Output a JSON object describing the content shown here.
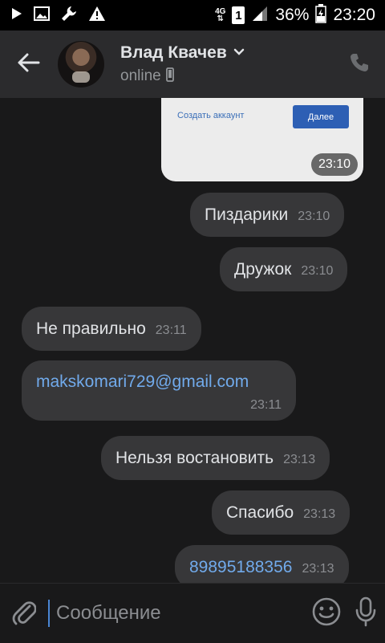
{
  "status_bar": {
    "battery": "36%",
    "time": "23:20",
    "network": "4G",
    "sim": "1",
    "icons": [
      "play-icon",
      "image-icon",
      "wrench-icon",
      "warning-icon",
      "signal-icon",
      "battery-icon"
    ]
  },
  "header": {
    "name": "Влад Квачев",
    "status": "online",
    "icons": [
      "back-arrow-icon",
      "chevron-down-icon",
      "phone-device-icon",
      "call-icon"
    ]
  },
  "image_message": {
    "link_text": "Создать аккаунт",
    "button_text": "Далее",
    "time": "23:10"
  },
  "messages": [
    {
      "text": "Пиздарики",
      "time": "23:10",
      "side": "out"
    },
    {
      "text": "Дружок",
      "time": "23:10",
      "side": "out"
    },
    {
      "text": "Не правильно",
      "time": "23:11",
      "side": "in"
    },
    {
      "text": "makskomari729@gmail.com",
      "time": "23:11",
      "side": "in",
      "link": true
    },
    {
      "text": "Нельзя востановить",
      "time": "23:13",
      "side": "out"
    },
    {
      "text": "Спасибо",
      "time": "23:13",
      "side": "out"
    },
    {
      "text": "89895188356",
      "time": "23:13",
      "side": "out",
      "link": true
    }
  ],
  "composer": {
    "placeholder": "Сообщение",
    "icons": [
      "attach-icon",
      "emoji-icon",
      "microphone-icon"
    ]
  },
  "colors": {
    "background": "#19191a",
    "header": "#2b2b2d",
    "bubble": "#373739",
    "link": "#71aaeb",
    "accent": "#4a86d4"
  }
}
